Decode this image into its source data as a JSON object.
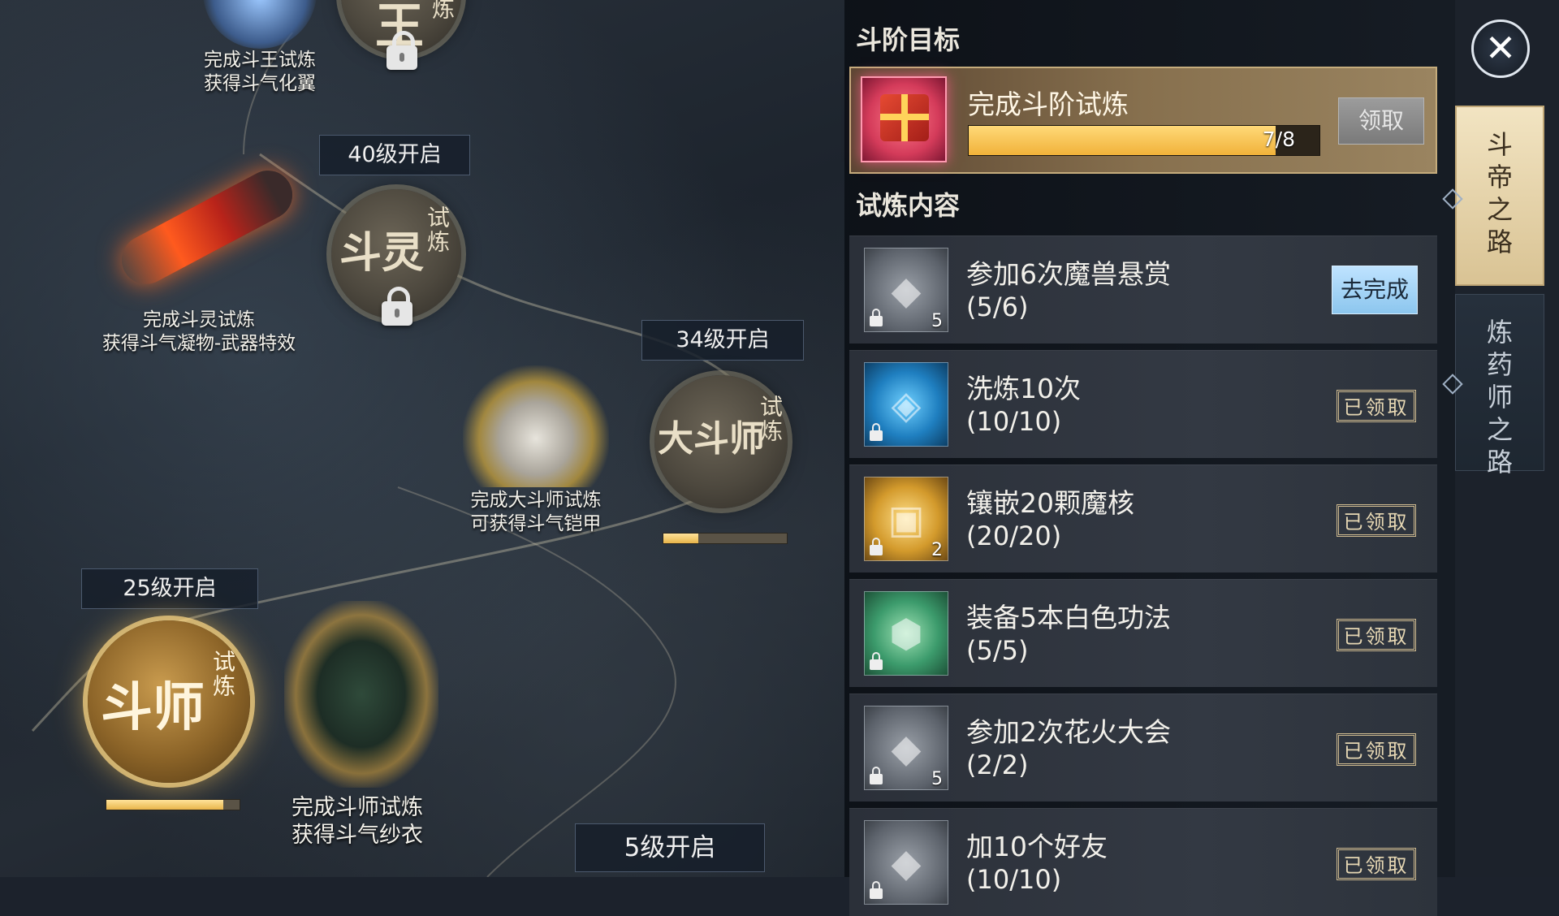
{
  "scene": {
    "top_caption": [
      "完成斗王试炼",
      "获得斗气化翼"
    ],
    "top_medal": {
      "big": "王",
      "small": "炼"
    },
    "douling": {
      "level_tag": "40级开启",
      "medal_big": "斗灵",
      "medal_small": "试炼",
      "caption": [
        "完成斗灵试炼",
        "获得斗气凝物-武器特效"
      ]
    },
    "dadoushi": {
      "level_tag": "34级开启",
      "medal_big": "大斗师",
      "medal_small": "试炼",
      "caption": [
        "完成大斗师试炼",
        "可获得斗气铠甲"
      ],
      "progress": 0.28
    },
    "doushi": {
      "level_tag": "25级开启",
      "medal_big": "斗师",
      "medal_small": "试炼",
      "caption": [
        "完成斗师试炼",
        "获得斗气纱衣"
      ],
      "progress": 0.88
    },
    "bottom_level_tag": "5级开启"
  },
  "panel": {
    "goal_section_title": "斗阶目标",
    "goal": {
      "title": "完成斗阶试炼",
      "progress_text": "7/8",
      "progress": 0.875,
      "claim_label": "领取"
    },
    "tasks_section_title": "试炼内容",
    "tasks": [
      {
        "name": "参加6次魔兽悬赏",
        "progress": "(5/6)",
        "icon": "stone-icon",
        "count": "5",
        "status": "go",
        "button": "去完成"
      },
      {
        "name": "洗炼10次",
        "progress": "(10/10)",
        "icon": "crystal-icon",
        "count": "",
        "status": "done",
        "button": "已领取"
      },
      {
        "name": "镶嵌20颗魔核",
        "progress": "(20/20)",
        "icon": "gift-box-icon",
        "count": "2",
        "status": "done",
        "button": "已领取"
      },
      {
        "name": "装备5本白色功法",
        "progress": "(5/5)",
        "icon": "rune-icon",
        "count": "",
        "status": "done",
        "button": "已领取"
      },
      {
        "name": "参加2次花火大会",
        "progress": "(2/2)",
        "icon": "stone-icon",
        "count": "5",
        "status": "done",
        "button": "已领取"
      },
      {
        "name": "加10个好友",
        "progress": "(10/10)",
        "icon": "stone-icon",
        "count": "",
        "status": "done",
        "button": "已领取"
      }
    ]
  },
  "side": {
    "close_icon": "close-icon",
    "tabs": [
      "斗帝之路",
      "炼药师之路"
    ]
  }
}
